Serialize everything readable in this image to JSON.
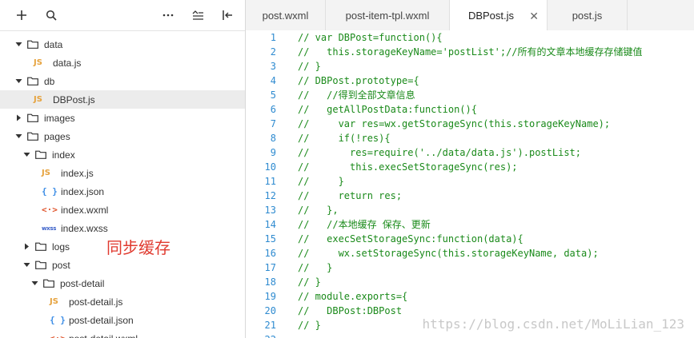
{
  "sidebar": {
    "tree": [
      {
        "label": "data",
        "type": "folder",
        "expanded": true,
        "level": 0
      },
      {
        "label": "data.js",
        "type": "js",
        "level": 1
      },
      {
        "label": "db",
        "type": "folder",
        "expanded": true,
        "level": 0
      },
      {
        "label": "DBPost.js",
        "type": "js",
        "level": 1,
        "selected": true
      },
      {
        "label": "images",
        "type": "folder",
        "expanded": false,
        "level": 0
      },
      {
        "label": "pages",
        "type": "folder",
        "expanded": true,
        "level": 0
      },
      {
        "label": "index",
        "type": "folder",
        "expanded": true,
        "level": 1
      },
      {
        "label": "index.js",
        "type": "js",
        "level": 2
      },
      {
        "label": "index.json",
        "type": "json",
        "level": 2
      },
      {
        "label": "index.wxml",
        "type": "wxml",
        "level": 2
      },
      {
        "label": "index.wxss",
        "type": "wxss",
        "level": 2
      },
      {
        "label": "logs",
        "type": "folder",
        "expanded": false,
        "level": 1
      },
      {
        "label": "post",
        "type": "folder",
        "expanded": true,
        "level": 1
      },
      {
        "label": "post-detail",
        "type": "folder",
        "expanded": true,
        "level": 2
      },
      {
        "label": "post-detail.js",
        "type": "js",
        "level": 3
      },
      {
        "label": "post-detail.json",
        "type": "json",
        "level": 3
      },
      {
        "label": "post-detail.wxml",
        "type": "wxml",
        "level": 3
      }
    ],
    "icons": {
      "js": "JS",
      "json": "{ }",
      "wxml": "<·>",
      "wxss": "wxss"
    }
  },
  "annotation": "同步缓存",
  "tabs": [
    {
      "label": "post.wxml"
    },
    {
      "label": "post-item-tpl.wxml"
    },
    {
      "label": "DBPost.js",
      "active": true,
      "close": "✕"
    },
    {
      "label": "post.js"
    }
  ],
  "code_lines": [
    "// var DBPost=function(){",
    "//   this.storageKeyName='postList';//所有的文章本地缓存存储键值",
    "// }",
    "// DBPost.prototype={",
    "//   //得到全部文章信息",
    "//   getAllPostData:function(){",
    "//     var res=wx.getStorageSync(this.storageKeyName);",
    "//     if(!res){",
    "//       res=require('../data/data.js').postList;",
    "//       this.execSetStorageSync(res);",
    "//     }",
    "//     return res;",
    "//   },",
    "//   //本地缓存 保存、更新",
    "//   execSetStorageSync:function(data){",
    "//     wx.setStorageSync(this.storageKeyName, data);",
    "//   }",
    "// }",
    "// module.exports={",
    "//   DBPost:DBPost",
    "// }",
    ""
  ],
  "watermark": "https://blog.csdn.net/MoLiLian_123",
  "colors": {
    "annotation": "#e03a2f",
    "line_numbers": "#2f8bd0",
    "comment": "#1a8a1a"
  }
}
